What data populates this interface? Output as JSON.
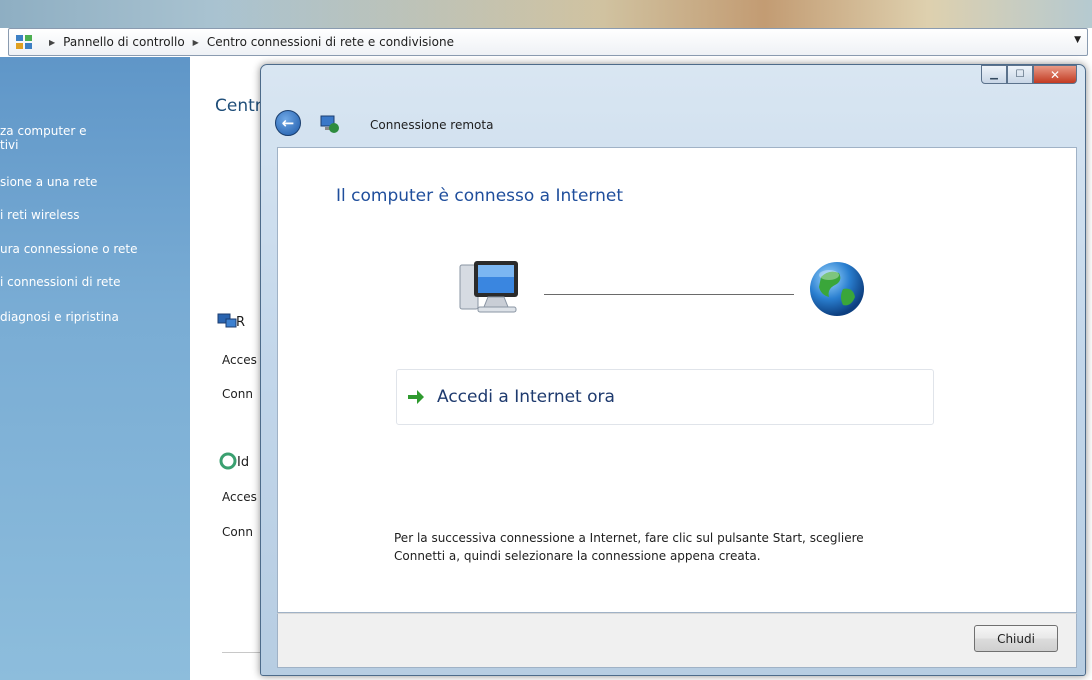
{
  "background_window": {
    "breadcrumb": [
      "Pannello di controllo",
      "Centro connessioni di rete e condivisione"
    ],
    "left_pane_links": [
      "za computer e",
      "tivi",
      "sione a una rete",
      "i reti wireless",
      "ura connessione o rete",
      "i connessioni di rete",
      "diagnosi e ripristina"
    ],
    "content_title": "Centr",
    "network1_label": "R",
    "network1_rows": [
      "Acces",
      "Conn"
    ],
    "network2_label": "Id",
    "network2_rows": [
      "Acces",
      "Conn"
    ]
  },
  "dialog": {
    "title": "Connessione remota",
    "heading": "Il computer è connesso a Internet",
    "command_link": "Accedi a Internet ora",
    "footer_line1": "Per la successiva connessione a Internet, fare clic sul pulsante Start, scegliere",
    "footer_line2": "Connetti a, quindi selezionare la connessione appena creata.",
    "close_button": "Chiudi"
  },
  "icons": {
    "back": "back-arrow-icon",
    "dialog_app": "network-connection-icon",
    "computer": "computer-icon",
    "globe": "internet-globe-icon",
    "command_arrow": "green-arrow-icon"
  }
}
